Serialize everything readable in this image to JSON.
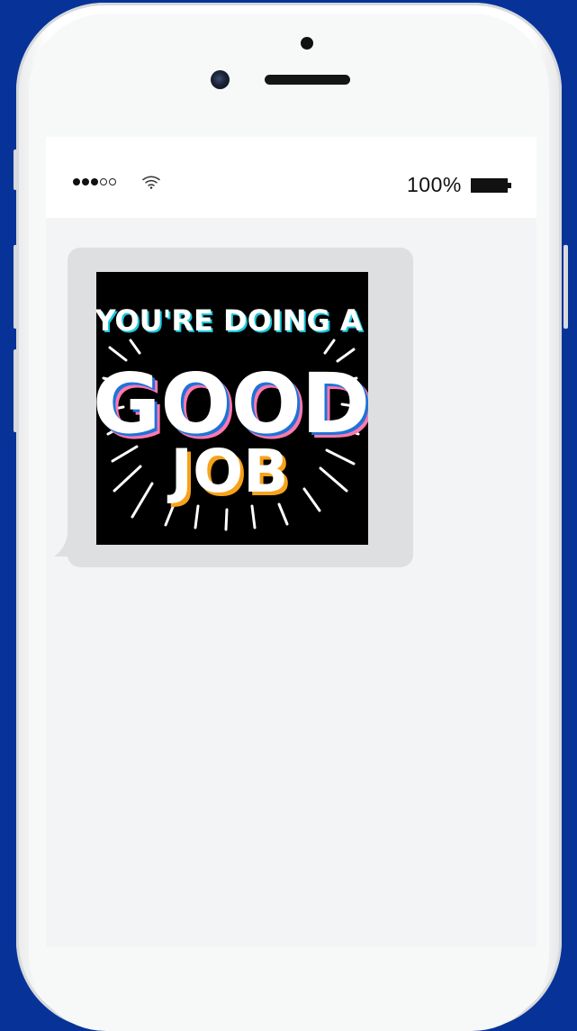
{
  "status_bar": {
    "signal_bars_filled": 3,
    "signal_bars_total": 5,
    "wifi_icon": "wifi-icon",
    "battery_text": "100%",
    "battery_icon": "battery-full-icon",
    "battery_level": 1.0
  },
  "message": {
    "sticker": {
      "line1": "YOU'RE DOING A",
      "line2": "GOOD",
      "line3": "JOB"
    }
  },
  "colors": {
    "background": "#073399",
    "screen": "#f3f4f6",
    "bubble": "#dedfe0",
    "sticker_bg": "#000000",
    "accent_cyan": "#19c7dc",
    "accent_pink": "#ff78b0",
    "accent_orange": "#f6a21a",
    "accent_blue": "#1e73d8"
  }
}
